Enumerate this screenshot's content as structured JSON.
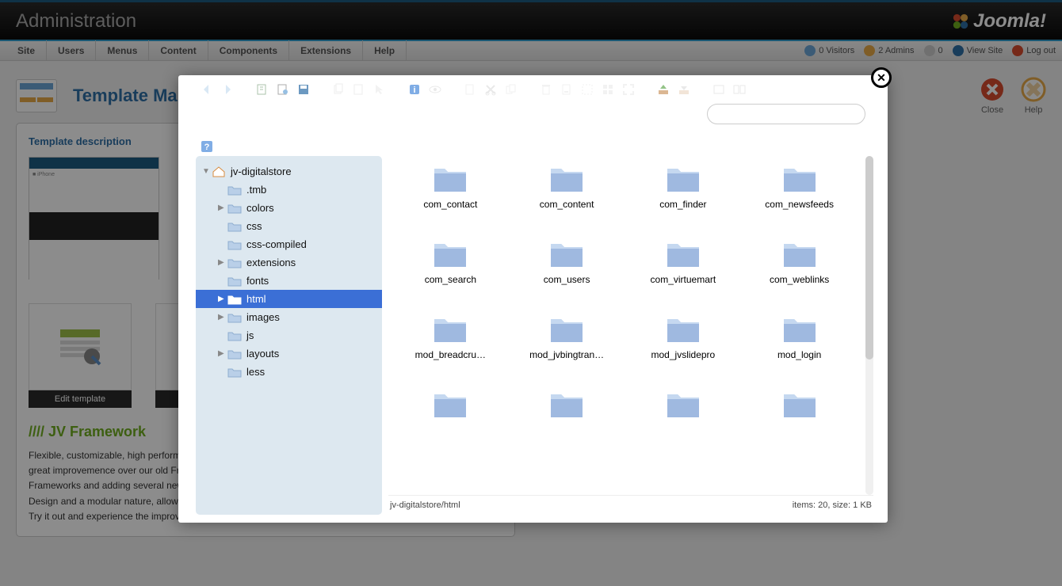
{
  "header": {
    "title": "Administration",
    "logo": "Joomla!"
  },
  "topmenu": [
    "Site",
    "Users",
    "Menus",
    "Content",
    "Components",
    "Extensions",
    "Help"
  ],
  "status": {
    "visitors": "0 Visitors",
    "admins": "2 Admins",
    "msgs": "0",
    "view_site": "View Site",
    "logout": "Log out"
  },
  "page": {
    "title": "Template Manager",
    "section": "Template description"
  },
  "toolbar": {
    "close": "Close",
    "help": "Help"
  },
  "thumbs": {
    "edit": "Edit template"
  },
  "framework": {
    "title": "//// JV Framework",
    "desc1": "Flexible, customizable, high performance, friendly for both developers and users. JV Framework version 3.0 is a great improvemence over our old Frameworks, while keeping the functions and advantages of the past Frameworks and adding several new ones, more up-to-date functions like a Grid layout control, a Responsive Design and a modular nature, allowing developers to improve or create new features with ease.",
    "desc2": "Try it out and experience the improvemence."
  },
  "fm": {
    "search_placeholder": "",
    "tree_root": "jv-digitalstore",
    "tree": [
      {
        "label": ".tmb",
        "expandable": false
      },
      {
        "label": "colors",
        "expandable": true
      },
      {
        "label": "css",
        "expandable": false
      },
      {
        "label": "css-compiled",
        "expandable": false
      },
      {
        "label": "extensions",
        "expandable": true
      },
      {
        "label": "fonts",
        "expandable": false
      },
      {
        "label": "html",
        "expandable": true,
        "active": true
      },
      {
        "label": "images",
        "expandable": true
      },
      {
        "label": "js",
        "expandable": false
      },
      {
        "label": "layouts",
        "expandable": true
      },
      {
        "label": "less",
        "expandable": false
      }
    ],
    "folders": [
      "com_contact",
      "com_content",
      "com_finder",
      "com_newsfeeds",
      "com_search",
      "com_users",
      "com_virtuemart",
      "com_weblinks",
      "mod_breadcru…",
      "mod_jvbingtran…",
      "mod_jvslidepro",
      "mod_login",
      "",
      "",
      "",
      ""
    ],
    "path": "jv-digitalstore/html",
    "status": "items: 20, size: 1 KB"
  }
}
